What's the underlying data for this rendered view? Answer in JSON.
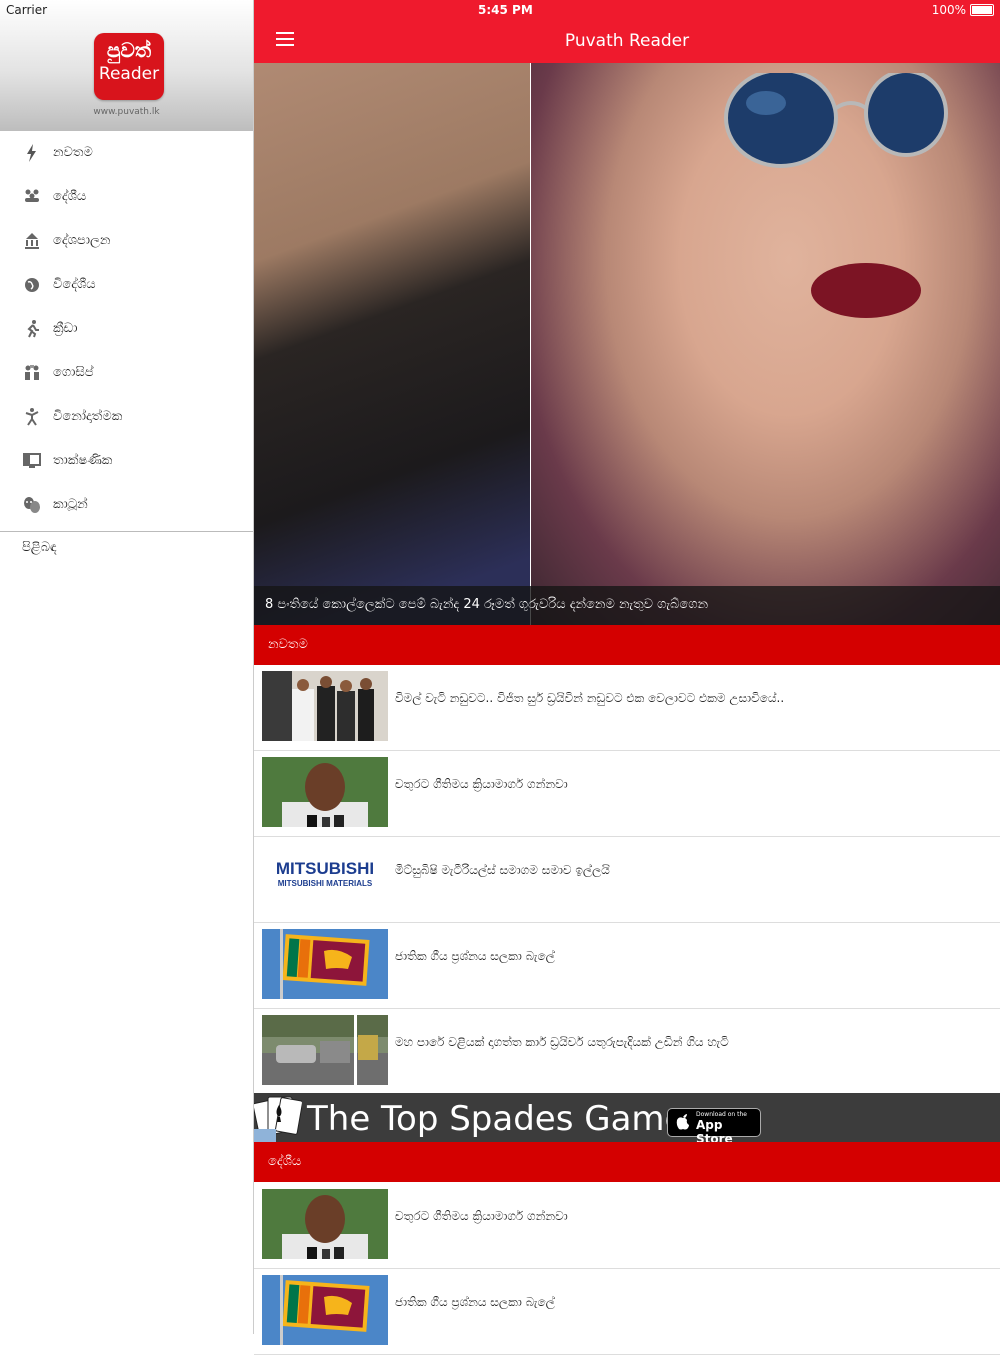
{
  "status": {
    "carrier": "Carrier",
    "time": "5:45 PM",
    "battery": "100%"
  },
  "sidebar": {
    "logo_line1": "පුවත්",
    "logo_line2": "Reader",
    "site": "www.puvath.lk",
    "items": [
      {
        "label": "නවතම",
        "icon": "lightning-icon"
      },
      {
        "label": "දේශීය",
        "icon": "people-icon"
      },
      {
        "label": "දේශපාලන",
        "icon": "parliament-icon"
      },
      {
        "label": "විදේශීය",
        "icon": "globe-icon"
      },
      {
        "label": "ක්‍රීඩා",
        "icon": "runner-icon"
      },
      {
        "label": "ගොසිප්",
        "icon": "gossip-icon"
      },
      {
        "label": "විනෝදාත්මක",
        "icon": "dancer-icon"
      },
      {
        "label": "තාක්ෂණික",
        "icon": "monitor-icon"
      },
      {
        "label": "කාටූන්",
        "icon": "masks-icon"
      }
    ],
    "about": "පිළිබඳ"
  },
  "nav": {
    "title": "Puvath Reader"
  },
  "hero": {
    "caption": "8 පංතියේ කොල්ලෙක්ට පෙම් බැන්ද 24 රූමත් ගුරුවරිය දන්නෙම නැතුව ගැබ්ගෙන"
  },
  "sections": [
    {
      "title": "නවතම",
      "items": [
        {
          "text": "විමල් වැටි නඩුවට.. විජිත සුර් ඩ්‍රයිවින් නඩුවට එක වෙලාවට එකම උසාවියේ..",
          "thumb": "politicians-photo"
        },
        {
          "text": "චතුරට ගීතිමය ක්‍රියාමාර්ග ගන්නවා",
          "thumb": "man-microphones-photo"
        },
        {
          "text": "මිට්සුබිෂි මැටීරියල්ස් සමාගම සමාව ඉල්ලයි",
          "thumb": "mitsubishi-logo",
          "logo_line1": "MITSUBISHI",
          "logo_line2": "MITSUBISHI MATERIALS"
        },
        {
          "text": "ජාතික ගීය ප්‍රශ්නය සලකා බැලේ",
          "thumb": "sri-lanka-flag"
        },
        {
          "text": "මහ පාරේ වළියක් දාගත්ත කාර් ඩ්‍රයිවර් යතුරුපැදියක් උඩින් ගිය හැටි",
          "thumb": "road-accident-photo"
        }
      ]
    },
    {
      "title": "දේශීය",
      "items": [
        {
          "text": "චතුරට ගීතිමය ක්‍රියාමාර්ග ගන්නවා",
          "thumb": "man-microphones-photo"
        },
        {
          "text": "ජාතික ගීය ප්‍රශ්නය සලකා බැලේ",
          "thumb": "sri-lanka-flag"
        }
      ]
    }
  ],
  "ad": {
    "text": "The Top Spades Game",
    "store_small": "Download on the",
    "store_big": "App Store"
  },
  "colors": {
    "nav": "#ef1a2d",
    "section": "#d40000",
    "logo": "#d8141c"
  }
}
